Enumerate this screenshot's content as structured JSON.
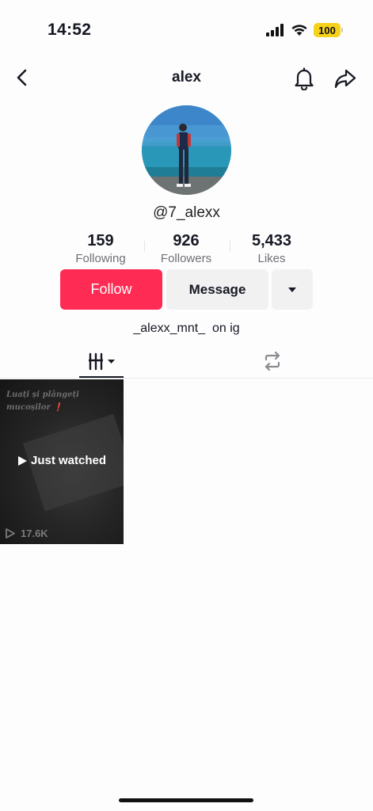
{
  "status_bar": {
    "time": "14:52",
    "battery": "100",
    "icons": [
      "signal-icon",
      "wifi-icon",
      "battery-icon"
    ]
  },
  "nav": {
    "title": "alex",
    "back_icon": "chevron-left-icon",
    "bell_icon": "bell-icon",
    "share_icon": "share-arrow-icon"
  },
  "profile": {
    "username": "@7_alexx",
    "stats": [
      {
        "value": "159",
        "label": "Following"
      },
      {
        "value": "926",
        "label": "Followers"
      },
      {
        "value": "5,433",
        "label": "Likes"
      }
    ],
    "actions": {
      "follow_label": "Follow",
      "message_label": "Message",
      "more_icon": "caret-down-icon"
    },
    "bio": "_alexx_mnt_  on ig"
  },
  "tabs": [
    {
      "name": "videos",
      "icon": "grid-lines-icon",
      "selected": true
    },
    {
      "name": "reposts",
      "icon": "repost-icon",
      "selected": false
    }
  ],
  "videos": [
    {
      "caption": "Luați și plângeți mucoșilor ❗",
      "overlay_label": "Just watched",
      "views": "17.6K"
    }
  ],
  "colors": {
    "accent": "#fe2c55",
    "button_secondary": "#f1f1f2",
    "text_primary": "#161823",
    "text_secondary": "#6f7076",
    "battery": "#f6d21b"
  }
}
